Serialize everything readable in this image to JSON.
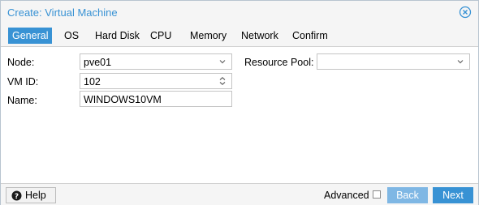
{
  "window": {
    "title": "Create: Virtual Machine",
    "accent_color": "#3892d4",
    "close_icon": "close-circle-icon"
  },
  "tabs": [
    {
      "label": "General",
      "active": true
    },
    {
      "label": "OS",
      "active": false
    },
    {
      "label": "Hard Disk",
      "active": false
    },
    {
      "label": "CPU",
      "active": false
    },
    {
      "label": "Memory",
      "active": false
    },
    {
      "label": "Network",
      "active": false
    },
    {
      "label": "Confirm",
      "active": false
    }
  ],
  "form": {
    "node": {
      "label": "Node:",
      "value": "pve01",
      "icon": "chevron-down-icon"
    },
    "vmid": {
      "label": "VM ID:",
      "value": "102",
      "icon": "spinner-updown-icon"
    },
    "name": {
      "label": "Name:",
      "value": "WINDOWS10VM"
    },
    "resource_pool": {
      "label": "Resource Pool:",
      "value": "",
      "icon": "chevron-down-icon"
    }
  },
  "footer": {
    "help_label": "Help",
    "help_icon": "question-circle-icon",
    "advanced_label": "Advanced",
    "advanced_checked": false,
    "back_label": "Back",
    "next_label": "Next"
  }
}
